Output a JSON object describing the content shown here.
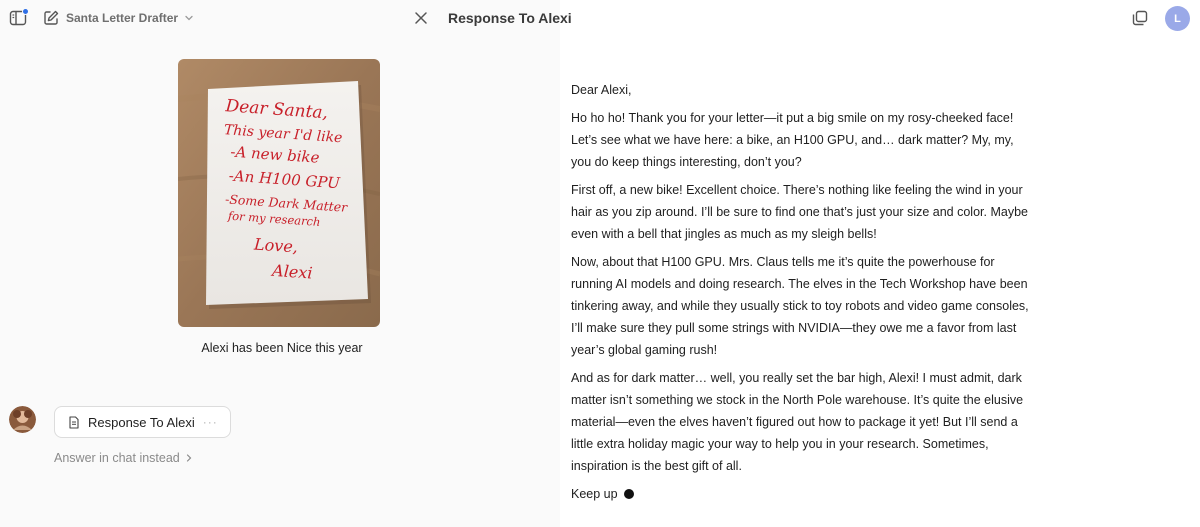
{
  "header": {
    "project_title": "Santa Letter Drafter",
    "document_title": "Response To Alexi",
    "profile_initial": "L"
  },
  "photo": {
    "handwriting": [
      "Dear Santa,",
      "This year I'd like",
      "-A new bike",
      "-An H100 GPU",
      "-Some Dark Matter",
      "for my research",
      "Love,",
      "Alexi"
    ],
    "caption": "Alexi has been Nice this year"
  },
  "chat": {
    "artifact_label": "Response To Alexi",
    "artifact_menu": "···",
    "answer_in_chat": "Answer in chat instead"
  },
  "letter": {
    "greeting": "Dear Alexi,",
    "paragraphs": [
      "Ho ho ho! Thank you for your letter—it put a big smile on my rosy-cheeked face! Let’s see what we have here: a bike, an H100 GPU, and… dark matter? My, my, you do keep things interesting, don’t you?",
      "First off, a new bike! Excellent choice. There’s nothing like feeling the wind in your hair as you zip around. I’ll be sure to find one that’s just your size and color. Maybe even with a bell that jingles as much as my sleigh bells!",
      "Now, about that H100 GPU. Mrs. Claus tells me it’s quite the powerhouse for running AI models and doing research. The elves in the Tech Workshop have been tinkering away, and while they usually stick to toy robots and video game consoles, I’ll make sure they pull some strings with NVIDIA—they owe me a favor from last year’s global gaming rush!",
      "And as for dark matter… well, you really set the bar high, Alexi! I must admit, dark matter isn’t something we stock in the North Pole warehouse. It’s quite the elusive material—even the elves haven’t figured out how to package it yet! But I’ll send a little extra holiday magic your way to help you in your research. Sometimes, inspiration is the best gift of all."
    ],
    "closing": "Keep up"
  },
  "colors": {
    "accent_blue": "#2f6fe6",
    "ink_red": "#c8202a",
    "profile_bg": "#9aa9e8"
  }
}
